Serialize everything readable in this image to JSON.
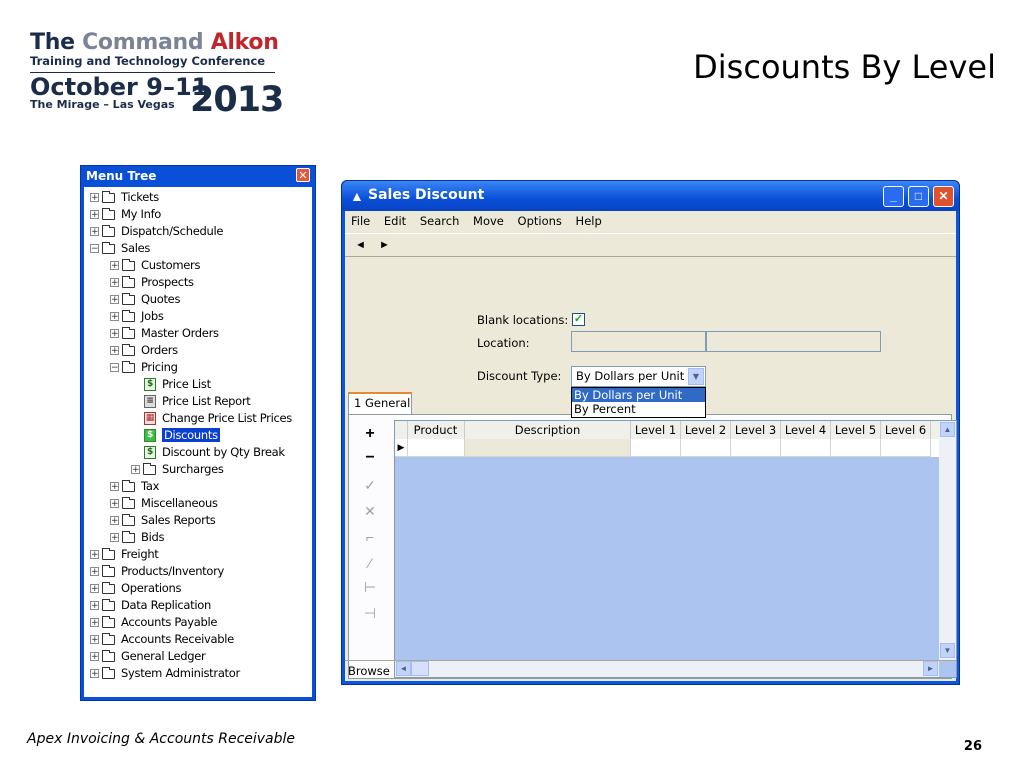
{
  "logo": {
    "line1_a": "The",
    "line1_b": "Command",
    "line1_c": "Alkon",
    "line2": "Training and Technology Conference",
    "line3": "October 9–11",
    "line4": "The Mirage – Las Vegas",
    "year": "2013"
  },
  "slide": {
    "title": "Discounts By Level",
    "footer": "Apex Invoicing & Accounts Receivable",
    "page_number": "26"
  },
  "menu_tree": {
    "title": "Menu Tree",
    "items": [
      {
        "label": "Tickets"
      },
      {
        "label": "My Info"
      },
      {
        "label": "Dispatch/Schedule"
      },
      {
        "label": "Sales"
      },
      {
        "label": "Customers"
      },
      {
        "label": "Prospects"
      },
      {
        "label": "Quotes"
      },
      {
        "label": "Jobs"
      },
      {
        "label": "Master Orders"
      },
      {
        "label": "Orders"
      },
      {
        "label": "Pricing"
      },
      {
        "label": "Price List"
      },
      {
        "label": "Price List Report"
      },
      {
        "label": "Change Price List Prices"
      },
      {
        "label": "Discounts"
      },
      {
        "label": "Discount by Qty Break"
      },
      {
        "label": "Surcharges"
      },
      {
        "label": "Tax"
      },
      {
        "label": "Miscellaneous"
      },
      {
        "label": "Sales Reports"
      },
      {
        "label": "Bids"
      },
      {
        "label": "Freight"
      },
      {
        "label": "Products/Inventory"
      },
      {
        "label": "Operations"
      },
      {
        "label": "Data Replication"
      },
      {
        "label": "Accounts Payable"
      },
      {
        "label": "Accounts Receivable"
      },
      {
        "label": "General Ledger"
      },
      {
        "label": "System Administrator"
      }
    ]
  },
  "window": {
    "title": "Sales Discount",
    "menu": [
      "File",
      "Edit",
      "Search",
      "Move",
      "Options",
      "Help"
    ],
    "form": {
      "blank_locations_label": "Blank locations:",
      "blank_locations_checked": true,
      "location_label": "Location:",
      "discount_type_label": "Discount Type:",
      "discount_type_value": "By Dollars per Unit",
      "discount_type_options": [
        "By Dollars per Unit",
        "By Percent"
      ]
    },
    "tab_label": "1 General",
    "grid_columns": [
      "Product",
      "Description",
      "Level 1",
      "Level 2",
      "Level 3",
      "Level 4",
      "Level 5",
      "Level 6"
    ],
    "status": "Browse"
  }
}
